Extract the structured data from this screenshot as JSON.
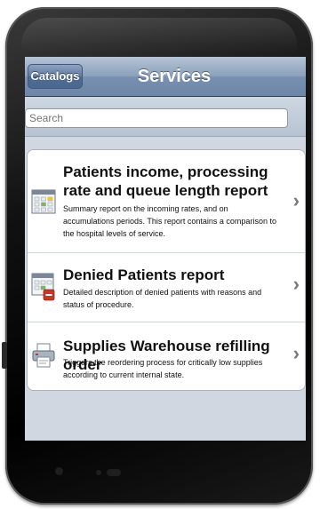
{
  "navbar": {
    "back_label": "Catalogs",
    "title": "Services"
  },
  "search": {
    "placeholder": "Search"
  },
  "services": [
    {
      "icon": "calendar-report-icon",
      "title": "Patients income, processing rate and queue length report",
      "description": "Summary report on the incoming rates, and on accumulations periods. This report contains a comparison to the hospital levels of service."
    },
    {
      "icon": "calendar-denied-icon",
      "title": "Denied Patients report",
      "description": "Detailed description of denied patients with reasons and status of procedure."
    },
    {
      "icon": "printer-icon",
      "title": "Supplies Warehouse refilling order",
      "description": "Triggers the reordering process for critically low supplies according to current internal state."
    }
  ],
  "colors": {
    "navbar": "#7891b1",
    "screen_background": "#d1d7e0",
    "denied_badge": "#c0392b"
  }
}
